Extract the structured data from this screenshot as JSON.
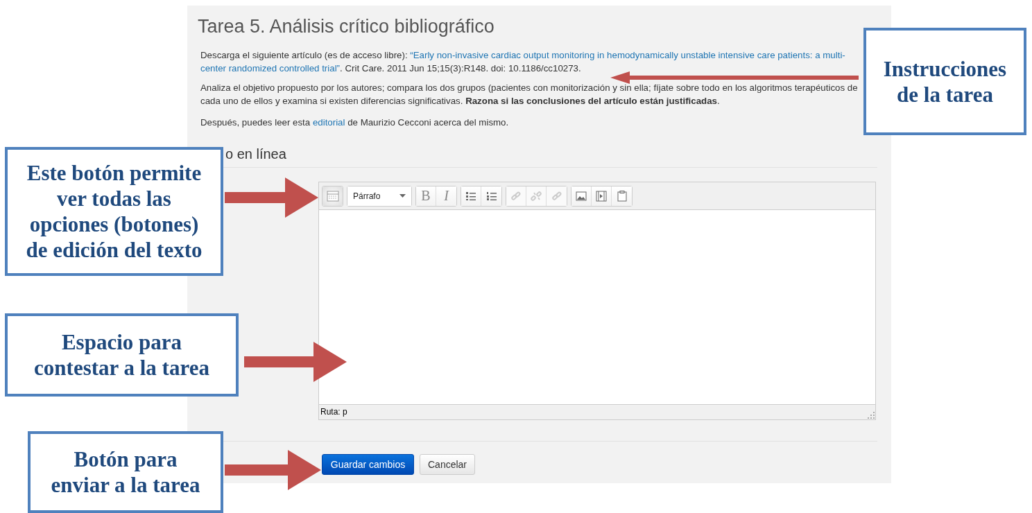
{
  "assignment": {
    "title": "Tarea 5. Análisis crítico bibliográfico",
    "paragraphs": [
      [
        {
          "kind": "text",
          "text": "Descarga el siguiente artículo (es de acceso libre): "
        },
        {
          "kind": "link",
          "text": "“Early non-invasive cardiac output monitoring in hemodynamically unstable intensive care patients: a multi-"
        },
        {
          "kind": "link",
          "text": "center randomized controlled trial”"
        },
        {
          "kind": "text",
          "text": ". Crit Care. 2011 Jun 15;15(3):R148. doi: 10.1186/cc10273."
        }
      ],
      [
        {
          "kind": "text",
          "text": "Analiza el objetivo propuesto por los autores; compara los dos grupos (pacientes con monitorización y sin ella; fíjate sobre todo en los algoritmos terapéuticos de cada uno de ellos y examina si existen diferencias significativas. **Razona si las conclusiones del artículo están justificadas**."
        }
      ],
      [
        {
          "kind": "text",
          "text": "Después, puedes leer esta "
        },
        {
          "kind": "link",
          "text": "editorial"
        },
        {
          "kind": "text",
          "text": " de Maurizio Cecconi acerca del mismo."
        }
      ]
    ],
    "section_heading": "o en línea",
    "editor": {
      "toolbar_groups": [
        [
          {
            "disabled": false
          }
        ],
        [
          {
            "label": "Párrafo",
            "disabled": false
          }
        ],
        [
          {
            "label": "B",
            "disabled": false
          },
          {
            "label": "I",
            "disabled": false
          }
        ],
        [
          {
            "disabled": false
          },
          {
            "disabled": false
          }
        ],
        [
          {
            "disabled": true
          },
          {
            "disabled": true
          },
          {
            "disabled": true
          }
        ],
        [
          {
            "disabled": false
          },
          {
            "disabled": false
          },
          {
            "disabled": false
          }
        ]
      ],
      "path": "Ruta: p"
    },
    "buttons": [
      {
        "kind": "primary",
        "label": "Guardar cambios"
      },
      {
        "kind": "default",
        "label": "Cancelar"
      }
    ]
  },
  "callouts": [
    {
      "kind": "instructions",
      "lines": [
        "Instrucciones",
        "de la tarea"
      ]
    },
    {
      "kind": "toolbar",
      "lines": [
        "Este botón permite",
        "ver todas las",
        "opciones (botones)",
        "de edición del texto"
      ]
    },
    {
      "kind": "answer",
      "lines": [
        "Espacio para",
        "contestar a la tarea"
      ]
    },
    {
      "kind": "submit",
      "lines": [
        "Botón para",
        "enviar a la tarea"
      ]
    }
  ]
}
